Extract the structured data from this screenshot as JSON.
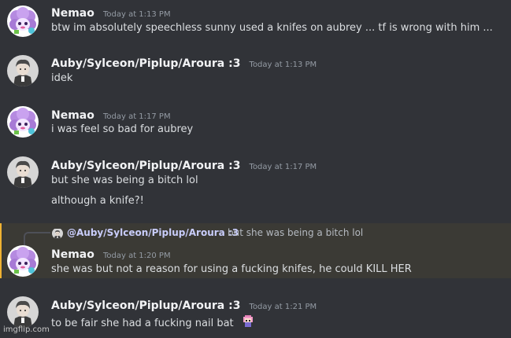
{
  "messages": [
    {
      "author": "Nemao",
      "timestamp": "Today at 1:13 PM",
      "lines": [
        "btw im absolutely speechless sunny used a knifes on aubrey ... tf is wrong with him ..."
      ],
      "avatar": "purple-sheep-avatar"
    },
    {
      "author": "Auby/Sylceon/Piplup/Aroura :3",
      "timestamp": "Today at 1:13 PM",
      "lines": [
        "idek"
      ],
      "avatar": "gray-character-avatar"
    },
    {
      "author": "Nemao",
      "timestamp": "Today at 1:17 PM",
      "lines": [
        "i was feel so bad for aubrey"
      ],
      "avatar": "purple-sheep-avatar"
    },
    {
      "author": "Auby/Sylceon/Piplup/Aroura :3",
      "timestamp": "Today at 1:17 PM",
      "lines": [
        "but she was being a bitch lol",
        "although a knife?!"
      ],
      "avatar": "gray-character-avatar"
    },
    {
      "author": "Nemao",
      "timestamp": "Today at 1:20 PM",
      "lines": [
        "she was but not a reason for using a fucking knifes, he could KILL HER"
      ],
      "avatar": "purple-sheep-avatar",
      "reply": {
        "mention": "@Auby/Sylceon/Piplup/Aroura :3",
        "text": "but she was being a bitch lol"
      }
    },
    {
      "author": "Auby/Sylceon/Piplup/Aroura :3",
      "timestamp": "Today at 1:21 PM",
      "lines": [
        "to be fair she had a fucking nail bat"
      ],
      "avatar": "gray-character-avatar",
      "emoji": "pink-pixel-character-emoji"
    }
  ],
  "watermark": "imgflip.com",
  "colors": {
    "background": "#313338",
    "highlight": "#3b3a35",
    "highlight_bar": "#f0b232",
    "mention": "#c9cdfb"
  }
}
